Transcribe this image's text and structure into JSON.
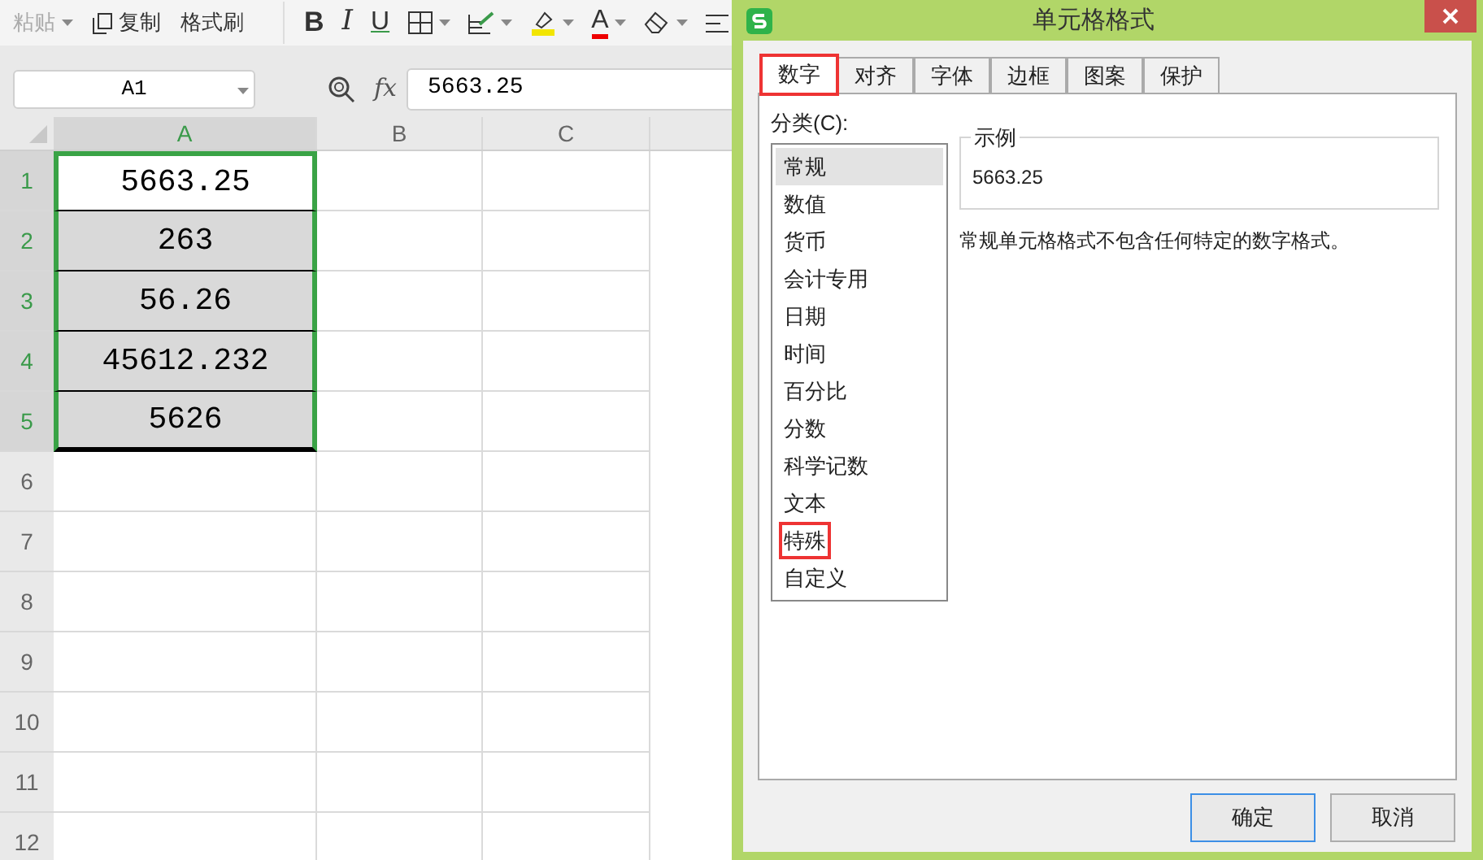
{
  "toolbar": {
    "clipboard": [
      {
        "kind": "paste",
        "label": "粘贴",
        "disabled": true,
        "dropdown": true
      },
      {
        "kind": "copy",
        "label": "复制",
        "disabled": false,
        "dropdown": false
      },
      {
        "kind": "painter",
        "label": "格式刷",
        "disabled": false,
        "dropdown": false
      }
    ],
    "format": [
      {
        "kind": "bold",
        "label": "B"
      },
      {
        "kind": "italic",
        "label": "I"
      },
      {
        "kind": "underline",
        "label": "U"
      },
      {
        "kind": "borders"
      },
      {
        "kind": "fill"
      },
      {
        "kind": "highlight"
      },
      {
        "kind": "font-color",
        "label": "A"
      },
      {
        "kind": "eraser"
      },
      {
        "kind": "align"
      }
    ]
  },
  "formula_bar": {
    "name_box": "A1",
    "fx": "fx",
    "value": "5663.25"
  },
  "sheet": {
    "columns": [
      {
        "label": "A",
        "selected": true
      },
      {
        "label": "B",
        "selected": false
      },
      {
        "label": "C",
        "selected": false
      }
    ],
    "rows": [
      {
        "header": "1",
        "selected": true,
        "active": true,
        "value": "5663.25"
      },
      {
        "header": "2",
        "selected": true,
        "active": false,
        "value": "263"
      },
      {
        "header": "3",
        "selected": true,
        "active": false,
        "value": "56.26"
      },
      {
        "header": "4",
        "selected": true,
        "active": false,
        "value": "45612.232"
      },
      {
        "header": "5",
        "selected": true,
        "active": false,
        "value": "5626"
      },
      {
        "header": "6",
        "selected": false,
        "active": false
      },
      {
        "header": "7",
        "selected": false,
        "active": false
      },
      {
        "header": "8",
        "selected": false,
        "active": false
      },
      {
        "header": "9",
        "selected": false,
        "active": false
      },
      {
        "header": "10",
        "selected": false,
        "active": false
      },
      {
        "header": "11",
        "selected": false,
        "active": false
      },
      {
        "header": "12",
        "selected": false,
        "active": false
      }
    ]
  },
  "dialog": {
    "title": "单元格格式",
    "tabs": [
      {
        "label": "数字",
        "selected": true,
        "highlighted": true
      },
      {
        "label": "对齐",
        "selected": false,
        "highlighted": false
      },
      {
        "label": "字体",
        "selected": false,
        "highlighted": false
      },
      {
        "label": "边框",
        "selected": false,
        "highlighted": false
      },
      {
        "label": "图案",
        "selected": false,
        "highlighted": false
      },
      {
        "label": "保护",
        "selected": false,
        "highlighted": false
      }
    ],
    "category_label": "分类(C):",
    "categories": [
      {
        "label": "常规",
        "selected": true,
        "highlighted": false
      },
      {
        "label": "数值",
        "selected": false,
        "highlighted": false
      },
      {
        "label": "货币",
        "selected": false,
        "highlighted": false
      },
      {
        "label": "会计专用",
        "selected": false,
        "highlighted": false
      },
      {
        "label": "日期",
        "selected": false,
        "highlighted": false
      },
      {
        "label": "时间",
        "selected": false,
        "highlighted": false
      },
      {
        "label": "百分比",
        "selected": false,
        "highlighted": false
      },
      {
        "label": "分数",
        "selected": false,
        "highlighted": false
      },
      {
        "label": "科学记数",
        "selected": false,
        "highlighted": false
      },
      {
        "label": "文本",
        "selected": false,
        "highlighted": false
      },
      {
        "label": "特殊",
        "selected": false,
        "highlighted": true
      },
      {
        "label": "自定义",
        "selected": false,
        "highlighted": false
      }
    ],
    "sample": {
      "title": "示例",
      "value": "5663.25"
    },
    "description": "常规单元格格式不包含任何特定的数字格式。",
    "buttons": [
      {
        "label": "确定",
        "focused": true
      },
      {
        "label": "取消",
        "focused": false
      }
    ]
  }
}
